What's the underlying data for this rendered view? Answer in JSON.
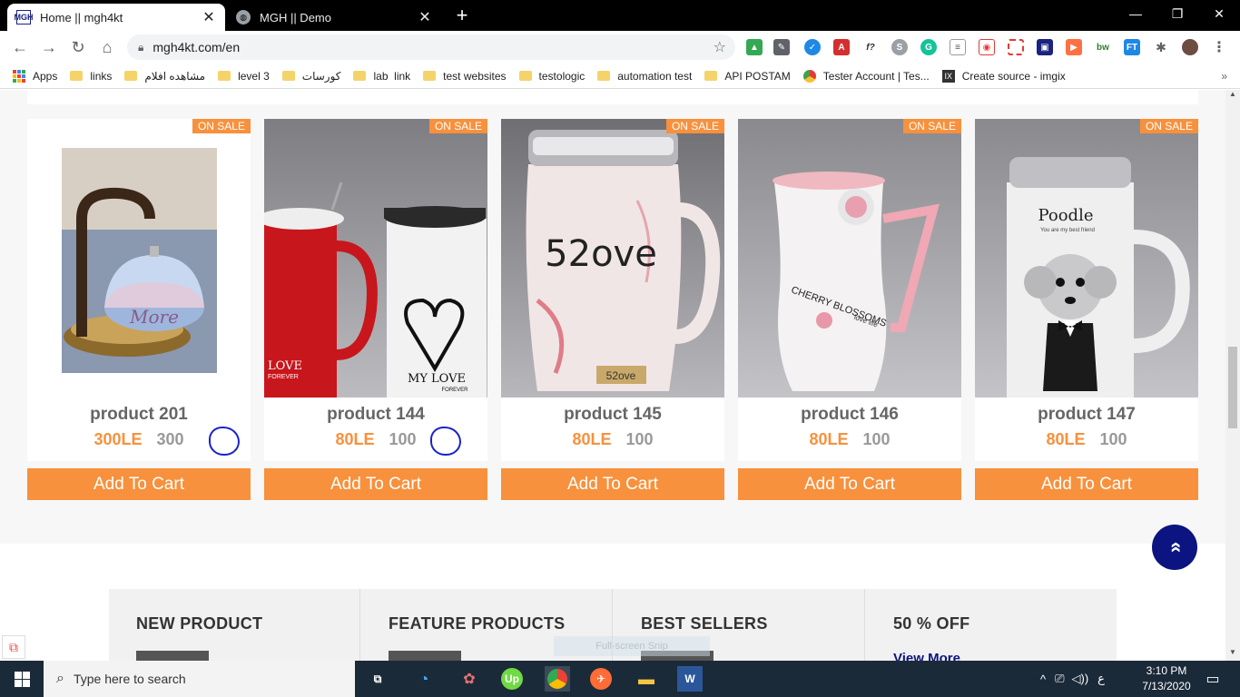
{
  "browser": {
    "tabs": [
      {
        "title": "Home || mgh4kt",
        "favicon": "MGH",
        "active": true
      },
      {
        "title": "MGH || Demo",
        "favicon": "globe",
        "active": false
      }
    ],
    "new_tab": "+",
    "url": "mgh4kt.com/en",
    "bookmarks": [
      "Apps",
      "links",
      "مشاهده افلام",
      "level 3",
      "كورسات",
      "lab  link",
      "test websites",
      "testologic",
      "automation test",
      "API POSTAM",
      "Tester Account | Tes...",
      "Create source - imgix"
    ],
    "bookmarks_more": "»"
  },
  "products": [
    {
      "name": "product 201",
      "price": "300LE",
      "old_price": "300",
      "badge": "ON SALE",
      "button": "Add To Cart",
      "annotated": true
    },
    {
      "name": "product 144",
      "price": "80LE",
      "old_price": "100",
      "badge": "ON SALE",
      "button": "Add To Cart",
      "annotated": true
    },
    {
      "name": "product 145",
      "price": "80LE",
      "old_price": "100",
      "badge": "ON SALE",
      "button": "Add To Cart",
      "annotated": false
    },
    {
      "name": "product 146",
      "price": "80LE",
      "old_price": "100",
      "badge": "ON SALE",
      "button": "Add To Cart",
      "annotated": false
    },
    {
      "name": "product 147",
      "price": "80LE",
      "old_price": "100",
      "badge": "ON SALE",
      "button": "Add To Cart",
      "annotated": false
    }
  ],
  "image_text": {
    "p201": "More",
    "p144_left": "LOVE",
    "p144_left_sub": "FOREVER",
    "p144_right": "MY LOVE",
    "p144_right_sub": "FOREVER",
    "p145": "52ove",
    "p145_tag": "52ove",
    "p146": "CHERRY BLOSSOMS",
    "p146_sub": "love life",
    "p147": "Poodle",
    "p147_sub": "You are my best friend"
  },
  "scroll_top": "»",
  "promo": {
    "columns": [
      "NEW PRODUCT",
      "FEATURE PRODUCTS",
      "BEST SELLERS",
      "50 % OFF"
    ],
    "view_more": "View More",
    "fullscreen_hint": "Full-screen Snip"
  },
  "taskbar": {
    "search_placeholder": "Type here to search",
    "time": "3:10 PM",
    "date": "7/13/2020",
    "ime": "ع"
  },
  "colors": {
    "accent": "#f7913d",
    "navy": "#0b1480",
    "annotation": "#1a23c9"
  }
}
